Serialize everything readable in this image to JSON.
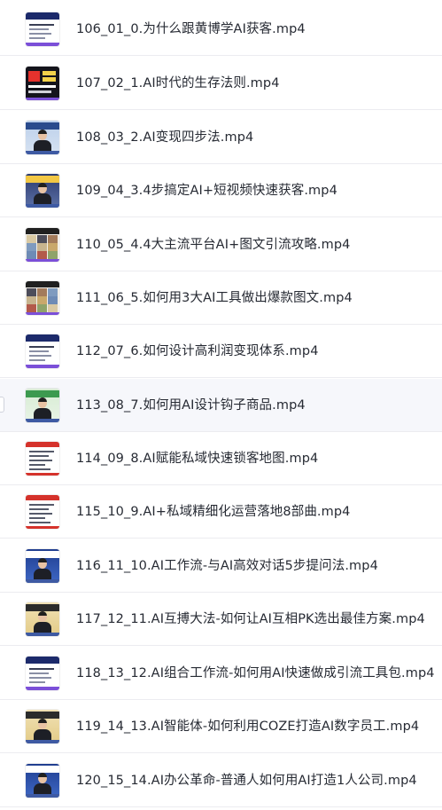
{
  "items": [
    {
      "title": "106_01_0.为什么跟黄博学AI获客.mp4",
      "thumb": "slide",
      "active": false
    },
    {
      "title": "107_02_1.AI时代的生存法则.mp4",
      "thumb": "dark",
      "active": false
    },
    {
      "title": "108_03_2.AI变现四步法.mp4",
      "thumb": "person",
      "active": false
    },
    {
      "title": "109_04_3.4步搞定AI+短视频快速获客.mp4",
      "thumb": "person",
      "active": false
    },
    {
      "title": "110_05_4.4大主流平台AI+图文引流攻略.mp4",
      "thumb": "grid",
      "active": false
    },
    {
      "title": "111_06_5.如何用3大AI工具做出爆款图文.mp4",
      "thumb": "grid",
      "active": false
    },
    {
      "title": "112_07_6.如何设计高利润变现体系.mp4",
      "thumb": "slide",
      "active": false
    },
    {
      "title": "113_08_7.如何用AI设计钩子商品.mp4",
      "thumb": "person-green",
      "active": true
    },
    {
      "title": "114_09_8.AI赋能私域快速锁客地图.mp4",
      "thumb": "red",
      "active": false
    },
    {
      "title": "115_10_9.AI+私域精细化运营落地8部曲.mp4",
      "thumb": "red",
      "active": false
    },
    {
      "title": "116_11_10.AI工作流-与AI高效对话5步提问法.mp4",
      "thumb": "person-blue",
      "active": false
    },
    {
      "title": "117_12_11.AI互搏大法-如何让AI互相PK选出最佳方案.mp4",
      "thumb": "person-gold",
      "active": false
    },
    {
      "title": "118_13_12.AI组合工作流-如何用AI快速做成引流工具包.mp4",
      "thumb": "slide",
      "active": false
    },
    {
      "title": "119_14_13.AI智能体-如何利用COZE打造AI数字员工.mp4",
      "thumb": "person-gold",
      "active": false
    },
    {
      "title": "120_15_14.AI办公革命-普通人如何用AI打造1人公司.mp4",
      "thumb": "person-blue",
      "active": false
    }
  ],
  "colors": {
    "text": "#262a33",
    "divider": "#ececf0",
    "active_bg": "#f6f7fb",
    "accent_purple": "#7b4fd8"
  }
}
